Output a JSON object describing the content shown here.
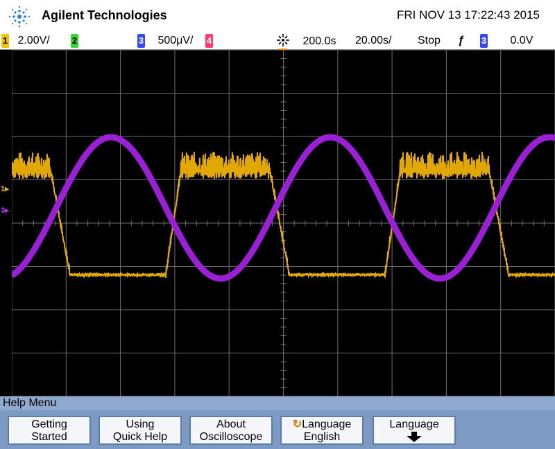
{
  "header": {
    "brand": "Agilent Technologies",
    "datetime": "FRI NOV 13 17:22:43 2015"
  },
  "status": {
    "ch1": {
      "num": "1",
      "scale": "2.00V/",
      "color": "#f5c400"
    },
    "ch2": {
      "num": "2",
      "color": "#33d633"
    },
    "ch3": {
      "num": "3",
      "scale": "500μV/",
      "color": "#3347ff"
    },
    "ch4": {
      "num": "4",
      "color": "#ff3a6f"
    },
    "time_ref": "200.0s",
    "time_scale": "20.00s/",
    "run_state": "Stop",
    "trigger_slope": "ƒ",
    "trigger_source": "3",
    "trigger_level": "0.0V"
  },
  "markers": {
    "ch1_label": "1",
    "ch3_label": "3"
  },
  "colors": {
    "ch1_trace": "#e0a800",
    "ch3_trace": "#9b1fd6",
    "grid": "#6f6f6f",
    "menubar": "#8fa9cf",
    "softkey_bg": "#7d9ac5"
  },
  "menu": {
    "title": "Help Menu",
    "softkeys": [
      {
        "line1": "Getting",
        "line2": "Started"
      },
      {
        "line1": "Using",
        "line2": "Quick Help"
      },
      {
        "line1": "About",
        "line2": "Oscilloscope"
      },
      {
        "line1": "Language",
        "line2": "English"
      },
      {
        "line1": "Language",
        "line2": ""
      }
    ]
  }
}
